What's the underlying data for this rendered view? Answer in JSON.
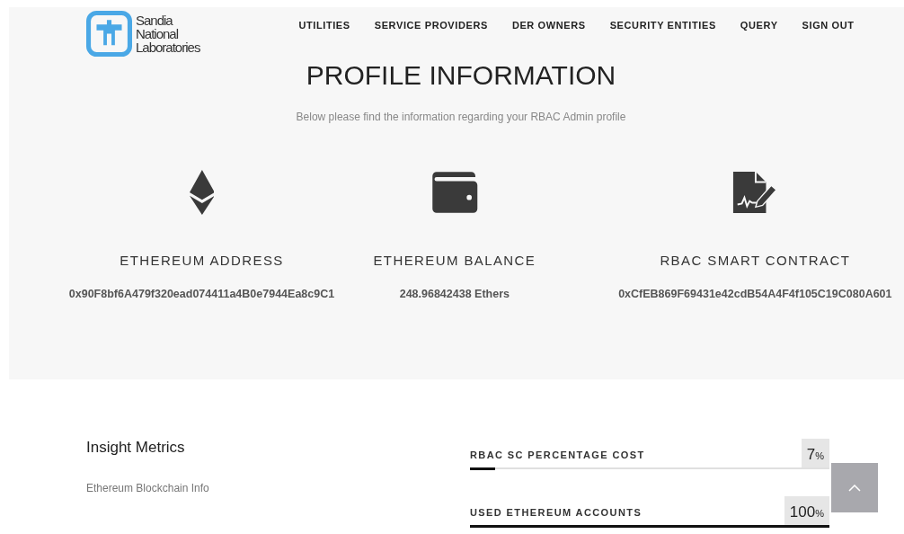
{
  "logo": {
    "lines": [
      "Sandia",
      "National",
      "Laboratories"
    ]
  },
  "nav": [
    {
      "label": "UTILITIES"
    },
    {
      "label": "SERVICE PROVIDERS"
    },
    {
      "label": "DER OWNERS"
    },
    {
      "label": "SECURITY ENTITIES"
    },
    {
      "label": "QUERY"
    },
    {
      "label": "SIGN OUT"
    }
  ],
  "title": "PROFILE INFORMATION",
  "subtitle": "Below please find the information regarding your RBAC Admin profile",
  "info": [
    {
      "kind": "ethereum",
      "label": "ETHEREUM ADDRESS",
      "value": "0x90F8bf6A479f320ead074411a4B0e7944Ea8c9C1"
    },
    {
      "kind": "wallet",
      "label": "ETHEREUM BALANCE",
      "value": "248.96842438 Ethers"
    },
    {
      "kind": "contract",
      "label": "RBAC SMART CONTRACT",
      "value": "0xCfEB869F69431e42cdB54A4F4f105C19C080A601"
    }
  ],
  "insight": {
    "heading": "Insight Metrics",
    "text": "Ethereum Blockchain Info"
  },
  "metrics": [
    {
      "label": "RBAC SC PERCENTAGE COST",
      "value": "7",
      "unit": "%",
      "level": 0.07
    },
    {
      "label": "USED ETHEREUM ACCOUNTS",
      "value": "100",
      "unit": "%",
      "level": 1
    }
  ]
}
